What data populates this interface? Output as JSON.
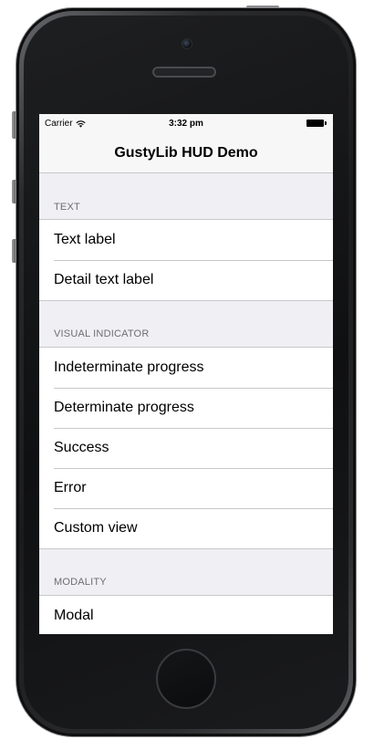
{
  "status_bar": {
    "carrier": "Carrier",
    "time": "3:32 pm",
    "wifi_icon": "wifi-icon",
    "battery_icon": "battery-icon"
  },
  "navbar": {
    "title": "GustyLib HUD Demo"
  },
  "sections": [
    {
      "header": "TEXT",
      "rows": [
        {
          "label": "Text label"
        },
        {
          "label": "Detail text label"
        }
      ]
    },
    {
      "header": "VISUAL INDICATOR",
      "rows": [
        {
          "label": "Indeterminate progress"
        },
        {
          "label": "Determinate progress"
        },
        {
          "label": "Success"
        },
        {
          "label": "Error"
        },
        {
          "label": "Custom view"
        }
      ]
    },
    {
      "header": "MODALITY",
      "rows": [
        {
          "label": "Modal"
        }
      ]
    }
  ],
  "colors": {
    "table_background": "#efeff4",
    "separator": "#c8c7cc",
    "section_header_text": "#6d6d72"
  }
}
